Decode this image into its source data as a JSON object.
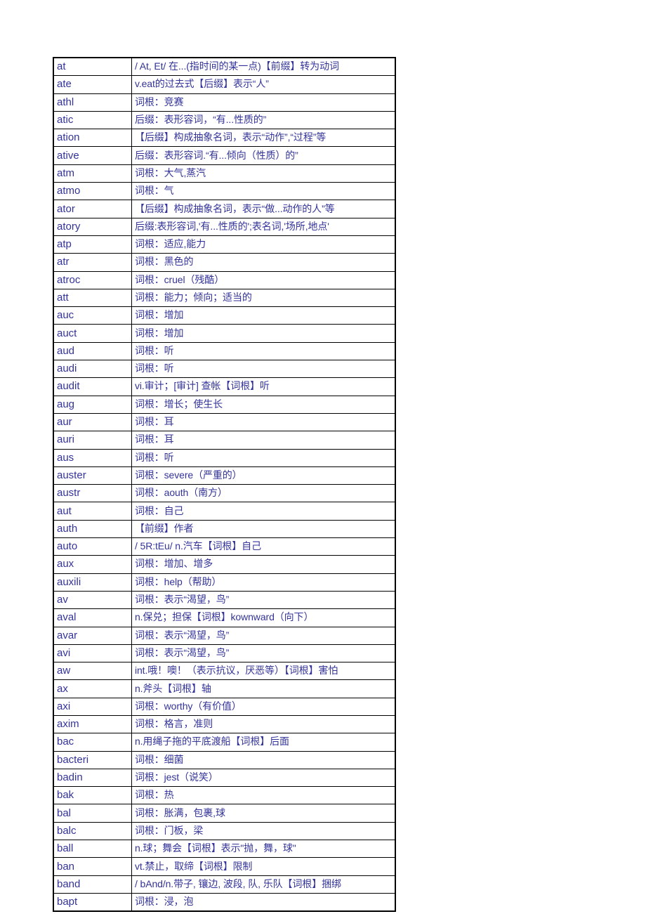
{
  "document": {
    "kind": "word-root-reference-table",
    "text_color": "#333399",
    "border_color": "#000000",
    "background": "#ffffff",
    "columns": [
      "",
      ""
    ],
    "rows": [
      {
        "term": "at",
        "definition": "/ At, Et/  在...(指时间的某一点)【前缀】转为动词"
      },
      {
        "term": "ate",
        "definition": "v.eat的过去式【后缀】表示“人”"
      },
      {
        "term": "athl",
        "definition": "词根：竞赛"
      },
      {
        "term": "atic",
        "definition": "后缀：表形容词，“有...性质的”"
      },
      {
        "term": "ation",
        "definition": "【后缀】构成抽象名词，表示“动作”,“过程”等"
      },
      {
        "term": "ative",
        "definition": "后缀：表形容词.“有...倾向（性质）的”"
      },
      {
        "term": "atm",
        "definition": "词根：大气,蒸汽"
      },
      {
        "term": "atmo",
        "definition": "词根：气"
      },
      {
        "term": "ator",
        "definition": "【后缀】构成抽象名词，表示“做...动作的人”等"
      },
      {
        "term": "atory",
        "definition": "后缀:表形容词,'有...性质的';表名词,'场所,地点'"
      },
      {
        "term": "atp",
        "definition": "词根：适应,能力"
      },
      {
        "term": "atr",
        "definition": "词根：黑色的"
      },
      {
        "term": "atroc",
        "definition": "词根：cruel（残酷）"
      },
      {
        "term": "att",
        "definition": "词根：能力；倾向；适当的"
      },
      {
        "term": "auc",
        "definition": "词根：增加"
      },
      {
        "term": "auct",
        "definition": "词根：增加"
      },
      {
        "term": "aud",
        "definition": "词根：听"
      },
      {
        "term": "audi",
        "definition": "词根：听"
      },
      {
        "term": "audit",
        "definition": "vi.审计；[审计] 查帐【词根】听"
      },
      {
        "term": "aug",
        "definition": "词根：增长；使生长"
      },
      {
        "term": "aur",
        "definition": "词根：耳"
      },
      {
        "term": "auri",
        "definition": "词根：耳"
      },
      {
        "term": "aus",
        "definition": "词根：听"
      },
      {
        "term": "auster",
        "definition": "词根：severe（严重的）"
      },
      {
        "term": "austr",
        "definition": "词根：aouth（南方）"
      },
      {
        "term": "aut",
        "definition": "词根：自己"
      },
      {
        "term": "auth",
        "definition": "【前缀】作者"
      },
      {
        "term": "auto",
        "definition": "/ 5R:tEu/  n.汽车【词根】自己"
      },
      {
        "term": "aux",
        "definition": "词根：增加、增多"
      },
      {
        "term": "auxili",
        "definition": "词根：help（帮助）"
      },
      {
        "term": "av",
        "definition": "词根：表示“渴望，鸟”"
      },
      {
        "term": "aval",
        "definition": "n.保兑；担保【词根】kownward（向下）"
      },
      {
        "term": "avar",
        "definition": "词根：表示“渴望，鸟”"
      },
      {
        "term": "avi",
        "definition": "词根：表示“渴望，鸟”"
      },
      {
        "term": "aw",
        "definition": "int.哦！噢！（表示抗议，厌恶等）【词根】害怕"
      },
      {
        "term": "ax",
        "definition": "n.斧头【词根】轴"
      },
      {
        "term": "axi",
        "definition": "词根：worthy（有价值）"
      },
      {
        "term": "axim",
        "definition": "词根：格言，准则"
      },
      {
        "term": "bac",
        "definition": "n.用绳子拖的平底渡船【词根】后面"
      },
      {
        "term": "bacteri",
        "definition": "词根：细菌"
      },
      {
        "term": "badin",
        "definition": "词根：jest（说笑）"
      },
      {
        "term": "bak",
        "definition": "词根：热"
      },
      {
        "term": "bal",
        "definition": "词根：胀满，包裹,球"
      },
      {
        "term": "balc",
        "definition": "词根：门板，梁"
      },
      {
        "term": "ball",
        "definition": "n.球；舞会【词根】表示\"抛，舞，球\""
      },
      {
        "term": "ban",
        "definition": "vt.禁止，取缔【词根】限制"
      },
      {
        "term": "band",
        "definition": "/ bAnd/n.带子, 镶边, 波段, 队, 乐队【词根】捆绑"
      },
      {
        "term": "bapt",
        "definition": "词根：浸，泡"
      }
    ]
  }
}
